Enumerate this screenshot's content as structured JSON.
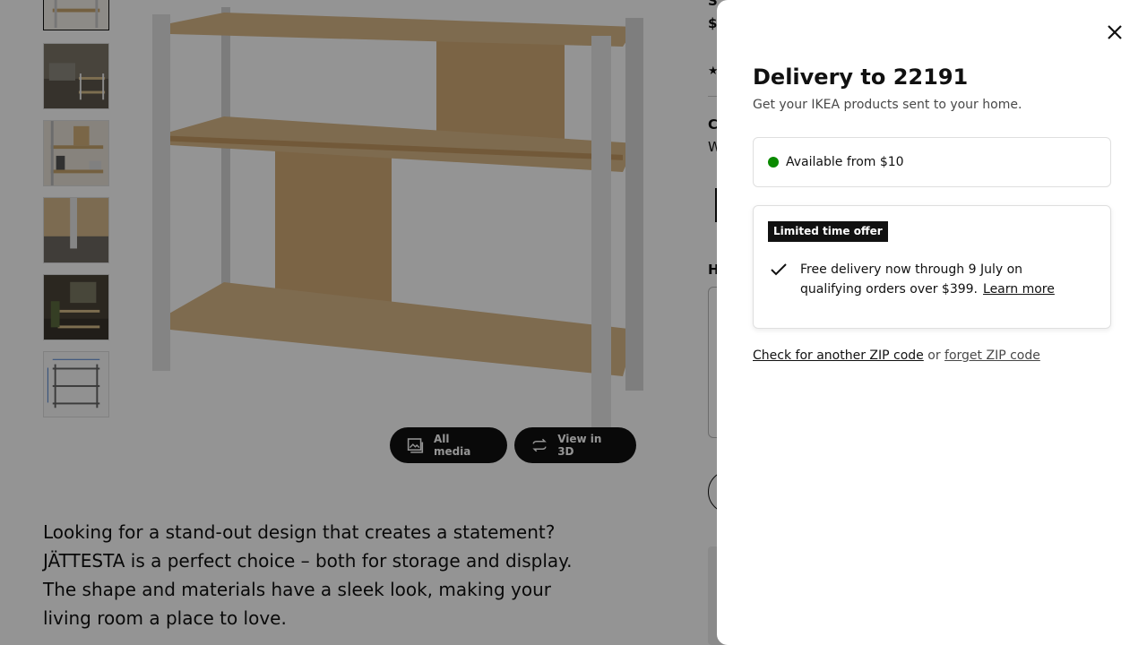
{
  "background": {
    "right_column_fragments": [
      "S",
      "$",
      "C",
      "W",
      "H"
    ],
    "media_buttons": {
      "all_media": "All media",
      "view_3d": "View in 3D"
    },
    "description": "Looking for a stand-out design that creates a statement? JÄTTESTA is a perfect choice – both for storage and display. The shape and materials have a sleek look, making your living room a place to love."
  },
  "drawer": {
    "title": "Delivery to 22191",
    "subtitle": "Get your IKEA products sent to your home.",
    "availability": {
      "text": "Available from $10",
      "status_color": "#0a8a00"
    },
    "offer": {
      "badge": "Limited time offer",
      "text": "Free delivery now through 9 July on qualifying orders over $399.",
      "link": "Learn more"
    },
    "zip": {
      "check_link": "Check for another ZIP code",
      "or": "or",
      "forget_link": "forget ZIP code"
    }
  }
}
